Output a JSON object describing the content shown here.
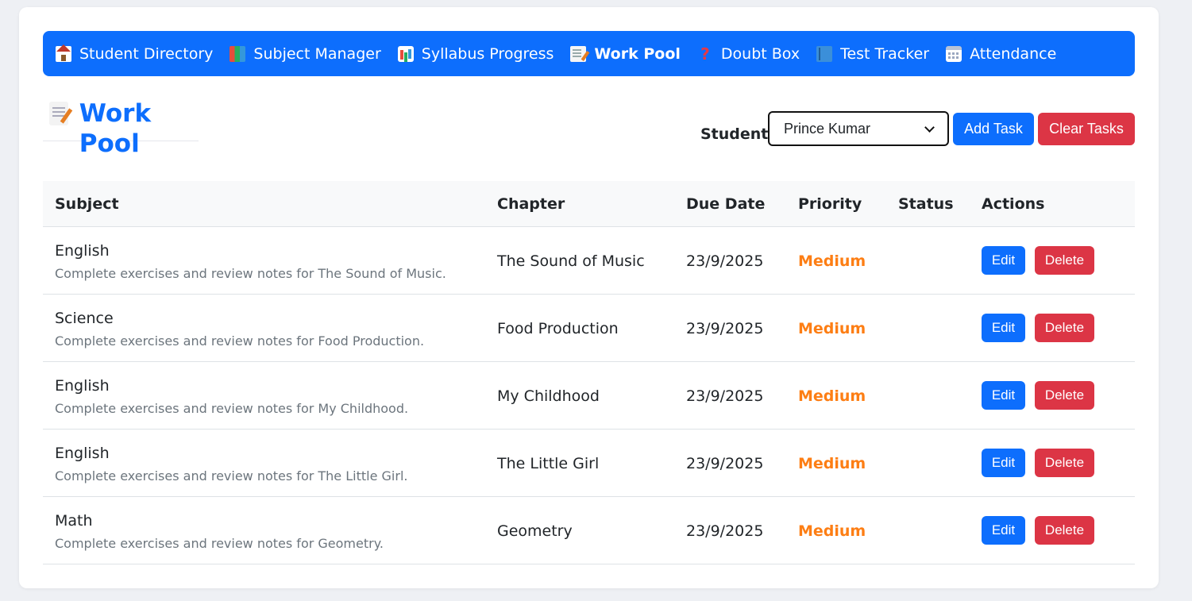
{
  "nav": {
    "items": [
      {
        "label": "Student Directory",
        "icon": "school-icon"
      },
      {
        "label": "Subject Manager",
        "icon": "books-icon"
      },
      {
        "label": "Syllabus Progress",
        "icon": "bar-chart-icon"
      },
      {
        "label": "Work Pool",
        "icon": "memo-icon",
        "active": true
      },
      {
        "label": "Doubt Box",
        "icon": "question-icon"
      },
      {
        "label": "Test Tracker",
        "icon": "book-icon"
      },
      {
        "label": "Attendance",
        "icon": "calendar-icon"
      }
    ]
  },
  "page": {
    "title": "Work Pool",
    "title_icon": "memo-icon"
  },
  "controls": {
    "student_label": "Student:",
    "student_selected": "Prince Kumar",
    "add_label": "Add Task",
    "clear_label": "Clear Tasks"
  },
  "table": {
    "headers": {
      "subject": "Subject",
      "chapter": "Chapter",
      "due": "Due Date",
      "priority": "Priority",
      "status": "Status",
      "actions": "Actions"
    },
    "rows": [
      {
        "subject": "English",
        "desc": "Complete exercises and review notes for The Sound of Music.",
        "chapter": "The Sound of Music",
        "due": "23/9/2025",
        "priority": "Medium",
        "status": "",
        "edit": "Edit",
        "delete": "Delete"
      },
      {
        "subject": "Science",
        "desc": "Complete exercises and review notes for Food Production.",
        "chapter": "Food Production",
        "due": "23/9/2025",
        "priority": "Medium",
        "status": "",
        "edit": "Edit",
        "delete": "Delete"
      },
      {
        "subject": "English",
        "desc": "Complete exercises and review notes for My Childhood.",
        "chapter": "My Childhood",
        "due": "23/9/2025",
        "priority": "Medium",
        "status": "",
        "edit": "Edit",
        "delete": "Delete"
      },
      {
        "subject": "English",
        "desc": "Complete exercises and review notes for The Little Girl.",
        "chapter": "The Little Girl",
        "due": "23/9/2025",
        "priority": "Medium",
        "status": "",
        "edit": "Edit",
        "delete": "Delete"
      },
      {
        "subject": "Math",
        "desc": "Complete exercises and review notes for Geometry.",
        "chapter": "Geometry",
        "due": "23/9/2025",
        "priority": "Medium",
        "status": "",
        "edit": "Edit",
        "delete": "Delete"
      }
    ]
  },
  "colors": {
    "primary": "#0d6efd",
    "danger": "#dc3545",
    "priority_medium": "#fd7e14"
  }
}
